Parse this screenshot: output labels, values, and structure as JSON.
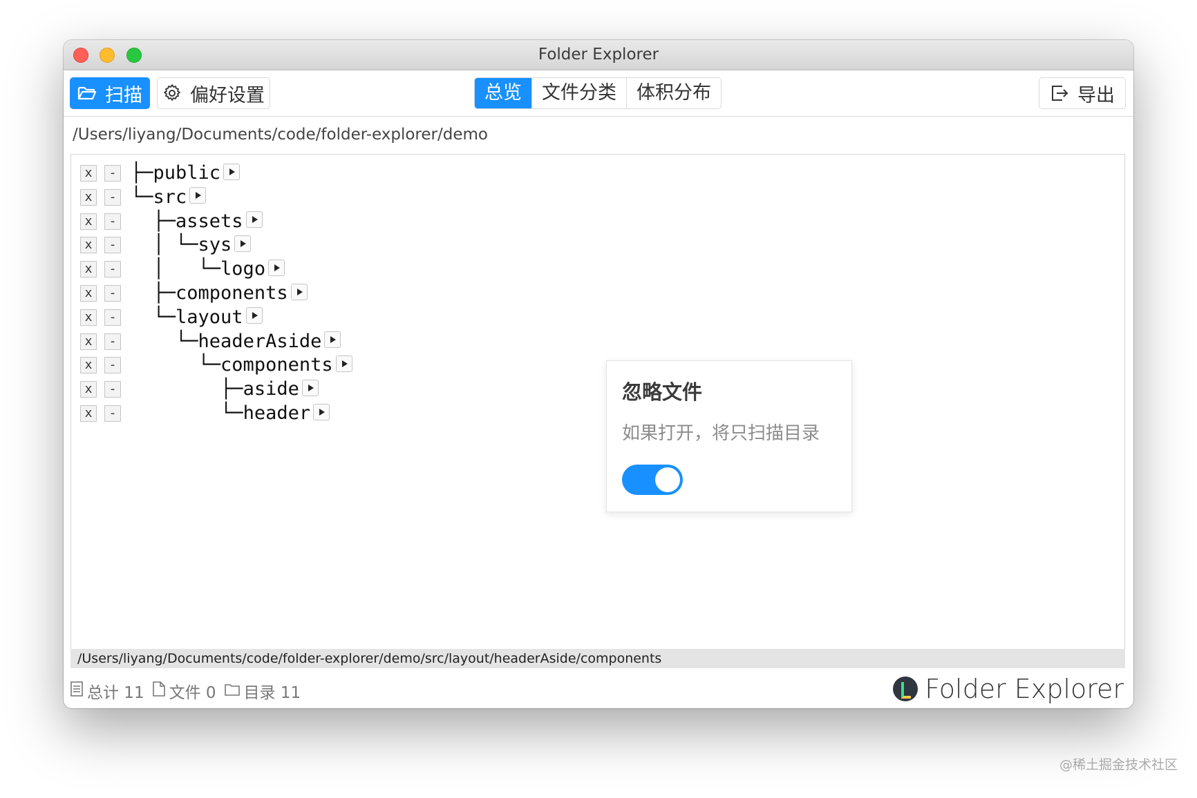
{
  "window": {
    "title": "Folder Explorer"
  },
  "toolbar": {
    "scan_label": "扫描",
    "prefs_label": "偏好设置",
    "tabs": [
      {
        "label": "总览",
        "active": true
      },
      {
        "label": "文件分类",
        "active": false
      },
      {
        "label": "体积分布",
        "active": false
      }
    ],
    "export_label": "导出"
  },
  "current_path": "/Users/liyang/Documents/code/folder-explorer/demo",
  "tree": {
    "remove_label": "x",
    "collapse_label": "-",
    "rows": [
      {
        "prefix": "├─",
        "name": "public"
      },
      {
        "prefix": "└─",
        "name": "src"
      },
      {
        "prefix": "  ├─",
        "name": "assets"
      },
      {
        "prefix": "  │ └─",
        "name": "sys"
      },
      {
        "prefix": "  │   └─",
        "name": "logo"
      },
      {
        "prefix": "  ├─",
        "name": "components"
      },
      {
        "prefix": "  └─",
        "name": "layout"
      },
      {
        "prefix": "    └─",
        "name": "headerAside"
      },
      {
        "prefix": "      └─",
        "name": "components"
      },
      {
        "prefix": "        ├─",
        "name": "aside"
      },
      {
        "prefix": "        └─",
        "name": "header"
      }
    ]
  },
  "popover": {
    "title": "忽略文件",
    "description": "如果打开，将只扫描目录",
    "toggle_on": true
  },
  "status_path": "/Users/liyang/Documents/code/folder-explorer/demo/src/layout/headerAside/components",
  "stats": {
    "total": "总计 11",
    "files": "文件 0",
    "dirs": "目录 11"
  },
  "brand": "Folder Explorer",
  "watermark": "@稀土掘金技术社区",
  "colors": {
    "accent": "#1890ff",
    "close": "#fe5f57",
    "minimize": "#febc2e",
    "zoom": "#28c840"
  }
}
